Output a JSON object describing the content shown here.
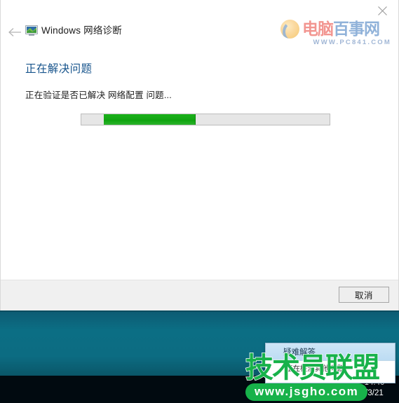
{
  "window": {
    "title": "Windows 网络诊断",
    "app_icon": "network-diagnostics-icon",
    "close_icon": "close-icon",
    "back_icon": "back-arrow-icon"
  },
  "content": {
    "heading": "正在解决问题",
    "status_text": "正在验证是否已解决 网络配置 问题...",
    "progress": {
      "style": "marquee",
      "chunk_start_percent": 9,
      "chunk_width_percent": 37,
      "track_color": "#e6e6e6",
      "chunk_color": "#15a615",
      "border_color": "#bcbcbc"
    }
  },
  "footer": {
    "cancel_label": "取消"
  },
  "watermark_pc841": {
    "text_cn": "电脑百事网",
    "text_cn_red_part": "电脑",
    "text_cn_blue_part": "百事网",
    "url": "WWW.PC841.COM",
    "logo_icon": "pc841-circle-logo",
    "red": "#e8352b",
    "blue": "#2b6cb8"
  },
  "watermark_jsgho": {
    "text_cn": "技术员联盟",
    "url": "www.jsgho.com",
    "green": "#17b24a"
  },
  "desktop": {
    "background_color": "#0b6e84"
  },
  "taskbar": {
    "background_color": "#010a10",
    "clock_time": "14:40",
    "clock_date": "/3/21"
  },
  "notification": {
    "title": "疑难解答",
    "body": "正在检测其他问题"
  }
}
